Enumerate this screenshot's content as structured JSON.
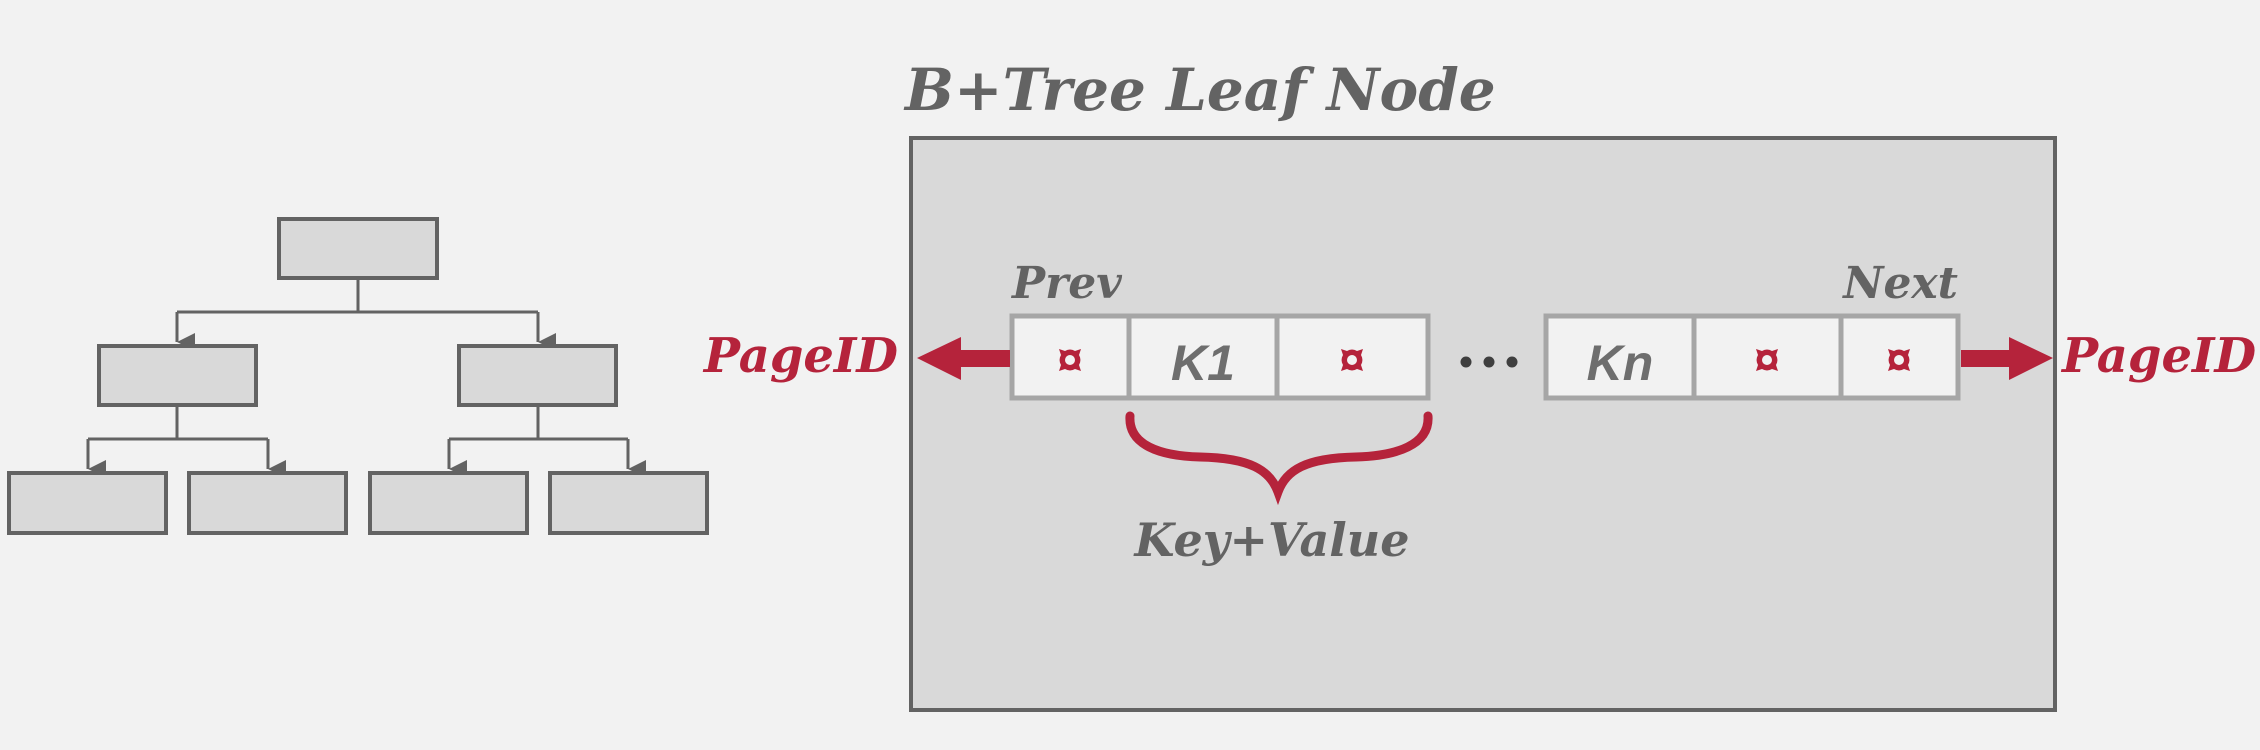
{
  "colors": {
    "background": "#f2f2f2",
    "node_fill": "#d9d9d9",
    "node_stroke": "#636363",
    "cell_fill": "#f2f2f2",
    "cell_stroke": "#a6a6a6",
    "accent": "#b5233b",
    "text_gray": "#636363",
    "dots": "#3f3f3f"
  },
  "title": "B+Tree Leaf Node",
  "tree": {
    "levels": [
      1,
      2,
      4
    ],
    "description": "three-level tree overview"
  },
  "leaf": {
    "prev_label": "Prev",
    "next_label": "Next",
    "left_page_label": "PageID",
    "right_page_label": "PageID",
    "ellipsis": "•••",
    "brace_label": "Key+Value",
    "left_group": [
      {
        "type": "pointer",
        "icon": "pointer-icon"
      },
      {
        "type": "key",
        "text": "K1"
      },
      {
        "type": "pointer",
        "icon": "pointer-icon"
      }
    ],
    "right_group": [
      {
        "type": "key",
        "text": "Kn"
      },
      {
        "type": "pointer",
        "icon": "pointer-icon"
      },
      {
        "type": "pointer",
        "icon": "pointer-icon"
      }
    ]
  }
}
